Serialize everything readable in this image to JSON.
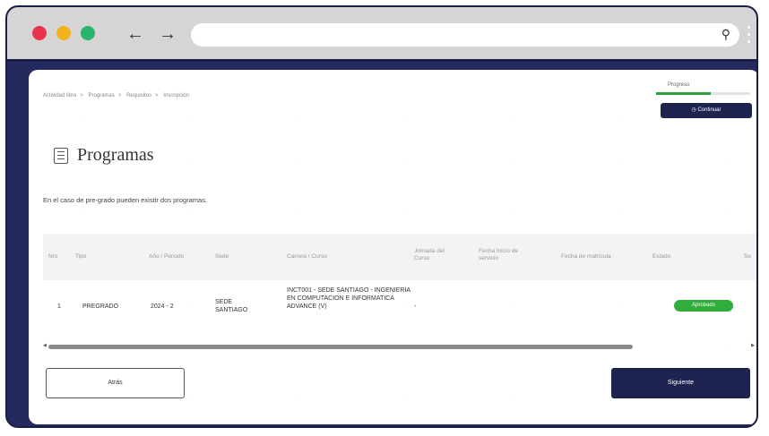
{
  "browser": {
    "dot_colors": [
      "#e9324b",
      "#f3b21b",
      "#2ab46c"
    ],
    "back_icon": "arrow-left-icon",
    "forward_icon": "arrow-right-icon",
    "search_icon": "search-icon"
  },
  "breadcrumb": [
    "Actividad libre",
    "Programas",
    "Requisitos",
    "Inscripción"
  ],
  "progress": {
    "label": "Progreso",
    "value": 0.58,
    "continue_label": "Continuar"
  },
  "page": {
    "title": "Programas",
    "intro": "En el caso de pre-grado pueden existir dos programas."
  },
  "table": {
    "headers": [
      "Nro",
      "Tipo",
      "Año / Periodo",
      "Sede",
      "Carrera / Curso",
      "Jornada del Curso",
      "Fecha Inicio de servicio",
      "Fecha de matrícula",
      "Estado",
      "Se"
    ],
    "rows": [
      {
        "nro": "1",
        "tipo": "PREGRADO",
        "periodo": "2024 - 2",
        "sede": "SEDE SANTIAGO",
        "carrera": "INCT001 - SEDE SANTIAGO - INGENIERIA EN COMPUTACION E INFORMATICA ADVANCE (V)",
        "jornada": "-",
        "estado": "Aprobado"
      }
    ]
  },
  "buttons": {
    "back": "Atrás",
    "next": "Siguiente"
  }
}
